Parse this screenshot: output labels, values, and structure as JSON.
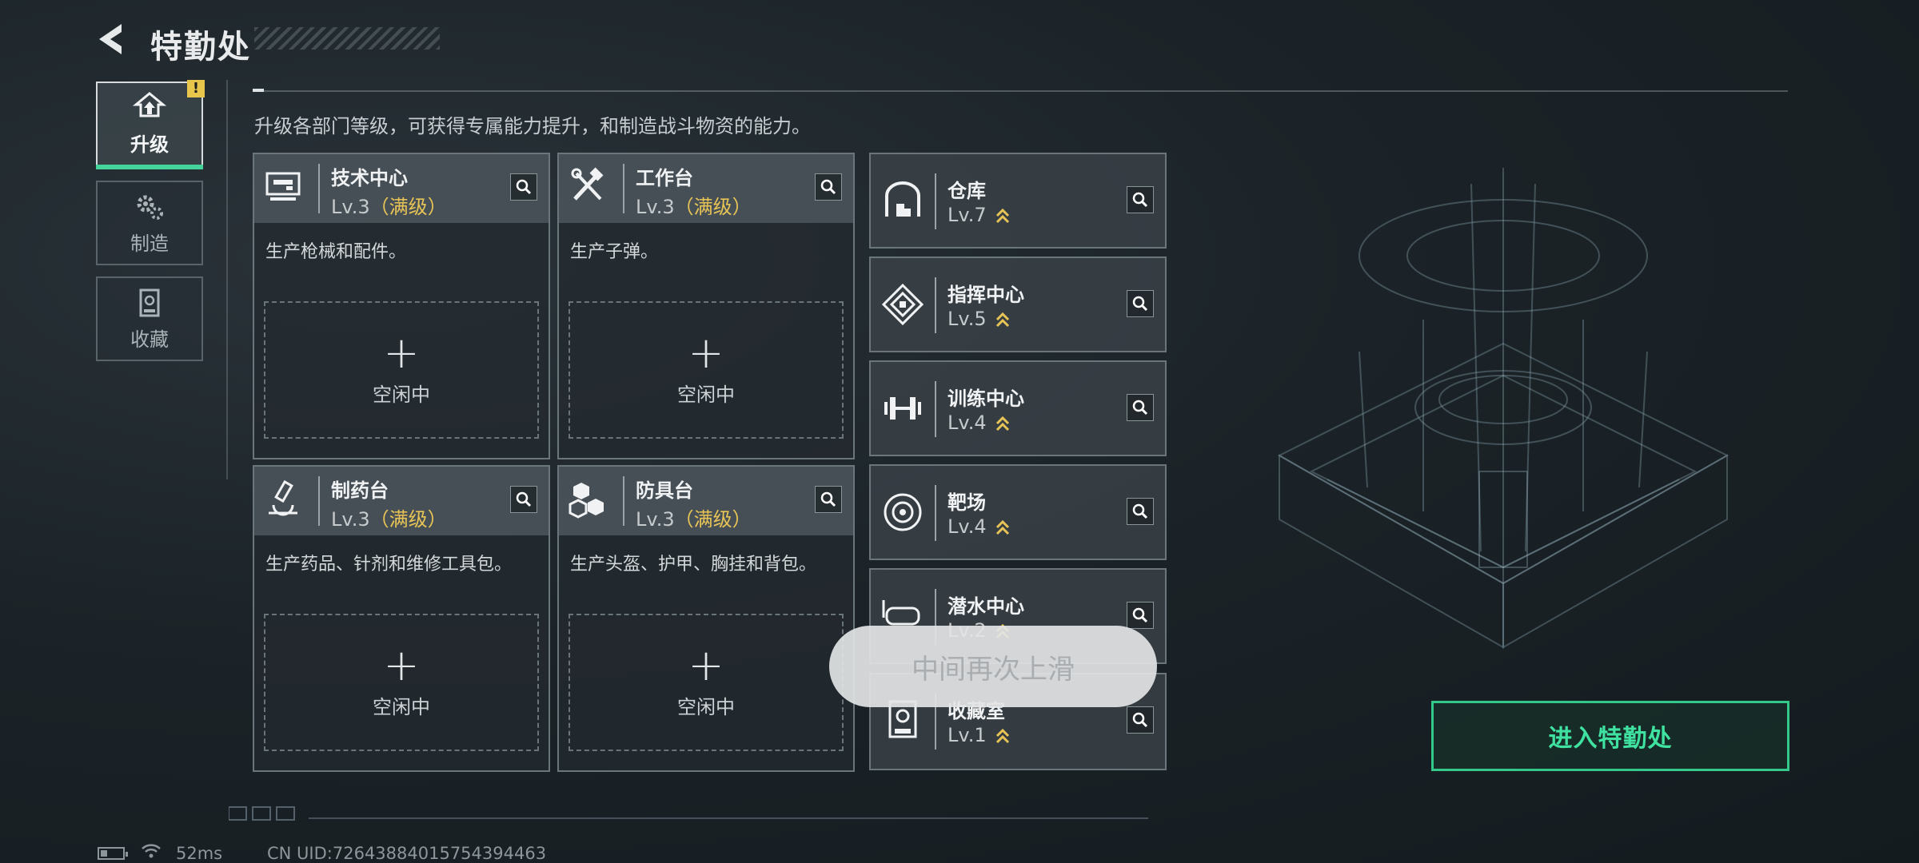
{
  "header": {
    "title": "特勤处"
  },
  "sidebar": {
    "alert_badge": "!",
    "tabs": [
      {
        "label": "升级",
        "icon": "upgrade-icon",
        "active": true
      },
      {
        "label": "制造",
        "icon": "gears-icon",
        "active": false
      },
      {
        "label": "收藏",
        "icon": "collection-icon",
        "active": false
      }
    ]
  },
  "intro": "升级各部门等级，可获得专属能力提升，和制造战斗物资的能力。",
  "facilities": [
    {
      "name": "技术中心",
      "level": "Lv.3",
      "max": "（满级）",
      "desc": "生产枪械和配件。",
      "slot": "空闲中",
      "icon": "tech-center-icon"
    },
    {
      "name": "工作台",
      "level": "Lv.3",
      "max": "（满级）",
      "desc": "生产子弹。",
      "slot": "空闲中",
      "icon": "workbench-icon"
    },
    {
      "name": "制药台",
      "level": "Lv.3",
      "max": "（满级）",
      "desc": "生产药品、针剂和维修工具包。",
      "slot": "空闲中",
      "icon": "pharmacy-icon"
    },
    {
      "name": "防具台",
      "level": "Lv.3",
      "max": "（满级）",
      "desc": "生产头盔、护甲、胸挂和背包。",
      "slot": "空闲中",
      "icon": "armor-bench-icon"
    }
  ],
  "departments": [
    {
      "name": "仓库",
      "level": "Lv.7",
      "icon": "warehouse-icon"
    },
    {
      "name": "指挥中心",
      "level": "Lv.5",
      "icon": "command-center-icon"
    },
    {
      "name": "训练中心",
      "level": "Lv.4",
      "icon": "training-center-icon"
    },
    {
      "name": "靶场",
      "level": "Lv.4",
      "icon": "shooting-range-icon"
    },
    {
      "name": "潜水中心",
      "level": "Lv.2",
      "icon": "diving-center-icon"
    },
    {
      "name": "收藏室",
      "level": "Lv.1",
      "icon": "collection-room-icon"
    }
  ],
  "toast": "中间再次上滑",
  "enter_button": "进入特勤处",
  "status": {
    "ping": "52ms",
    "uid": "CN UID:7264388401575439446​3"
  },
  "colors": {
    "accent_green": "#3fe2a0",
    "max_level_gold": "#e8c457",
    "active_tab_underline": "#45d49b"
  }
}
